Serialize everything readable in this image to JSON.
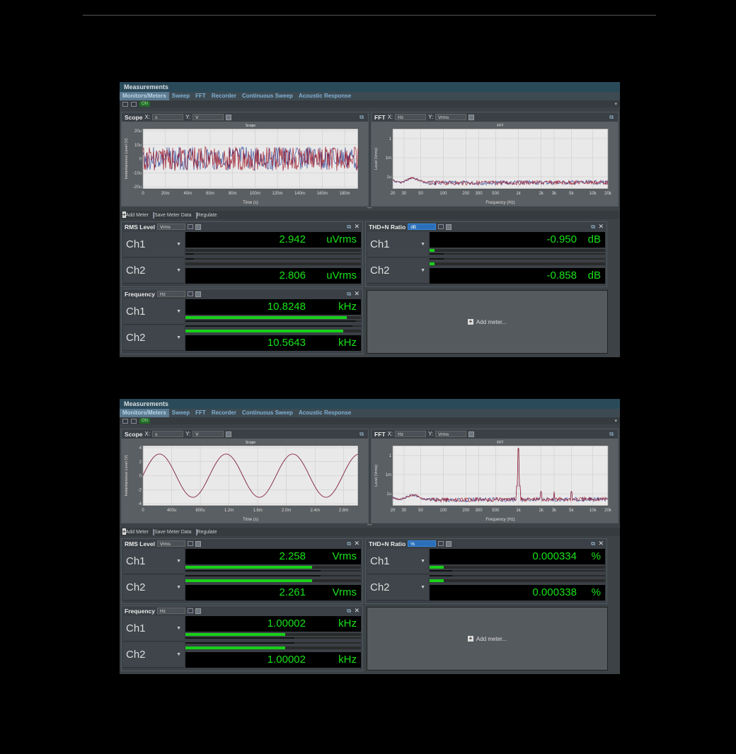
{
  "window_title": "Measurements",
  "tabs": [
    "Monitors/Meters",
    "Sweep",
    "FFT",
    "Recorder",
    "Continuous Sweep",
    "Acoustic Response"
  ],
  "toolbar": {
    "on_label": "ON"
  },
  "meter_toolbar": {
    "add_meter": "Add Meter",
    "save_meter_data": "Save Meter Data",
    "regulate": "Regulate"
  },
  "add_meter_placeholder": "Add meter...",
  "colors": {
    "ch1": "#3f4f9a",
    "ch2": "#a02030",
    "readout_green": "#18e018"
  },
  "windows": [
    {
      "scope": {
        "header": "Scope",
        "x_label": "X:",
        "x_unit": "s",
        "y_label": "Y:",
        "y_unit": "V",
        "title": "Scope",
        "xlabel": "Time (s)",
        "ylabel": "Instantaneous Level (V)",
        "yticks": [
          "20u",
          "10u",
          "0",
          "-10u",
          "-20u"
        ],
        "xticks": [
          "0",
          "20m",
          "40m",
          "60m",
          "80m",
          "100m",
          "120m",
          "140m",
          "160m",
          "180m"
        ],
        "signal": "noise"
      },
      "fft": {
        "header": "FFT",
        "x_label": "X:",
        "x_unit": "Hz",
        "y_label": "Y:",
        "y_unit": "Vrms",
        "title": "FFT",
        "xlabel": "Frequency (Hz)",
        "ylabel": "Level (Vrms)",
        "yticks": [
          "1",
          "1m",
          "1u"
        ],
        "xticks": [
          "20",
          "30",
          "50",
          "100",
          "200",
          "300",
          "500",
          "1k",
          "2k",
          "3k",
          "5k",
          "10k",
          "20k"
        ],
        "signal": "noise"
      },
      "rms": {
        "header": "RMS Level",
        "unit_select": "Vrms",
        "ch1": {
          "label": "Ch1",
          "value": "2.942",
          "unit": "uVrms",
          "level": 0
        },
        "ch2": {
          "label": "Ch2",
          "value": "2.806",
          "unit": "uVrms",
          "level": 0
        }
      },
      "thd": {
        "header": "THD+N Ratio",
        "unit_select": "dB",
        "ch1": {
          "label": "Ch1",
          "value": "-0.950",
          "unit": "dB",
          "level": 0.03
        },
        "ch2": {
          "label": "Ch2",
          "value": "-0.858",
          "unit": "dB",
          "level": 0.03
        }
      },
      "freq": {
        "header": "Frequency",
        "unit_select": "Hz",
        "ch1": {
          "label": "Ch1",
          "value": "10.8248",
          "unit": "kHz",
          "level": 0.92
        },
        "ch2": {
          "label": "Ch2",
          "value": "10.5643",
          "unit": "kHz",
          "level": 0.9
        }
      }
    },
    {
      "scope": {
        "header": "Scope",
        "x_label": "X:",
        "x_unit": "s",
        "y_label": "Y:",
        "y_unit": "V",
        "title": "Scope",
        "xlabel": "Time (s)",
        "ylabel": "Instantaneous Level (V)",
        "yticks": [
          "4",
          "2",
          "0",
          "-2",
          "-4"
        ],
        "xticks": [
          "0",
          "400u",
          "800u",
          "1.2m",
          "1.6m",
          "2.0m",
          "2.4m",
          "2.8m"
        ],
        "signal": "sine"
      },
      "fft": {
        "header": "FFT",
        "x_label": "X:",
        "x_unit": "Hz",
        "y_label": "Y:",
        "y_unit": "Vrms",
        "title": "FFT",
        "xlabel": "Frequency (Hz)",
        "ylabel": "Level (Vrms)",
        "yticks": [
          "1",
          "1m",
          "1u"
        ],
        "xticks": [
          "20",
          "30",
          "50",
          "100",
          "200",
          "300",
          "500",
          "1k",
          "2k",
          "3k",
          "5k",
          "10k",
          "20k"
        ],
        "signal": "tone"
      },
      "rms": {
        "header": "RMS Level",
        "unit_select": "Vrms",
        "ch1": {
          "label": "Ch1",
          "value": "2.258",
          "unit": "Vrms",
          "level": 0.72
        },
        "ch2": {
          "label": "Ch2",
          "value": "2.261",
          "unit": "Vrms",
          "level": 0.72
        }
      },
      "thd": {
        "header": "THD+N Ratio",
        "unit_select": "%",
        "ch1": {
          "label": "Ch1",
          "value": "0.000334",
          "unit": "%",
          "level": 0.08
        },
        "ch2": {
          "label": "Ch2",
          "value": "0.000338",
          "unit": "%",
          "level": 0.08
        }
      },
      "freq": {
        "header": "Frequency",
        "unit_select": "Hz",
        "ch1": {
          "label": "Ch1",
          "value": "1.00002",
          "unit": "kHz",
          "level": 0.57
        },
        "ch2": {
          "label": "Ch2",
          "value": "1.00002",
          "unit": "kHz",
          "level": 0.57
        }
      }
    }
  ]
}
